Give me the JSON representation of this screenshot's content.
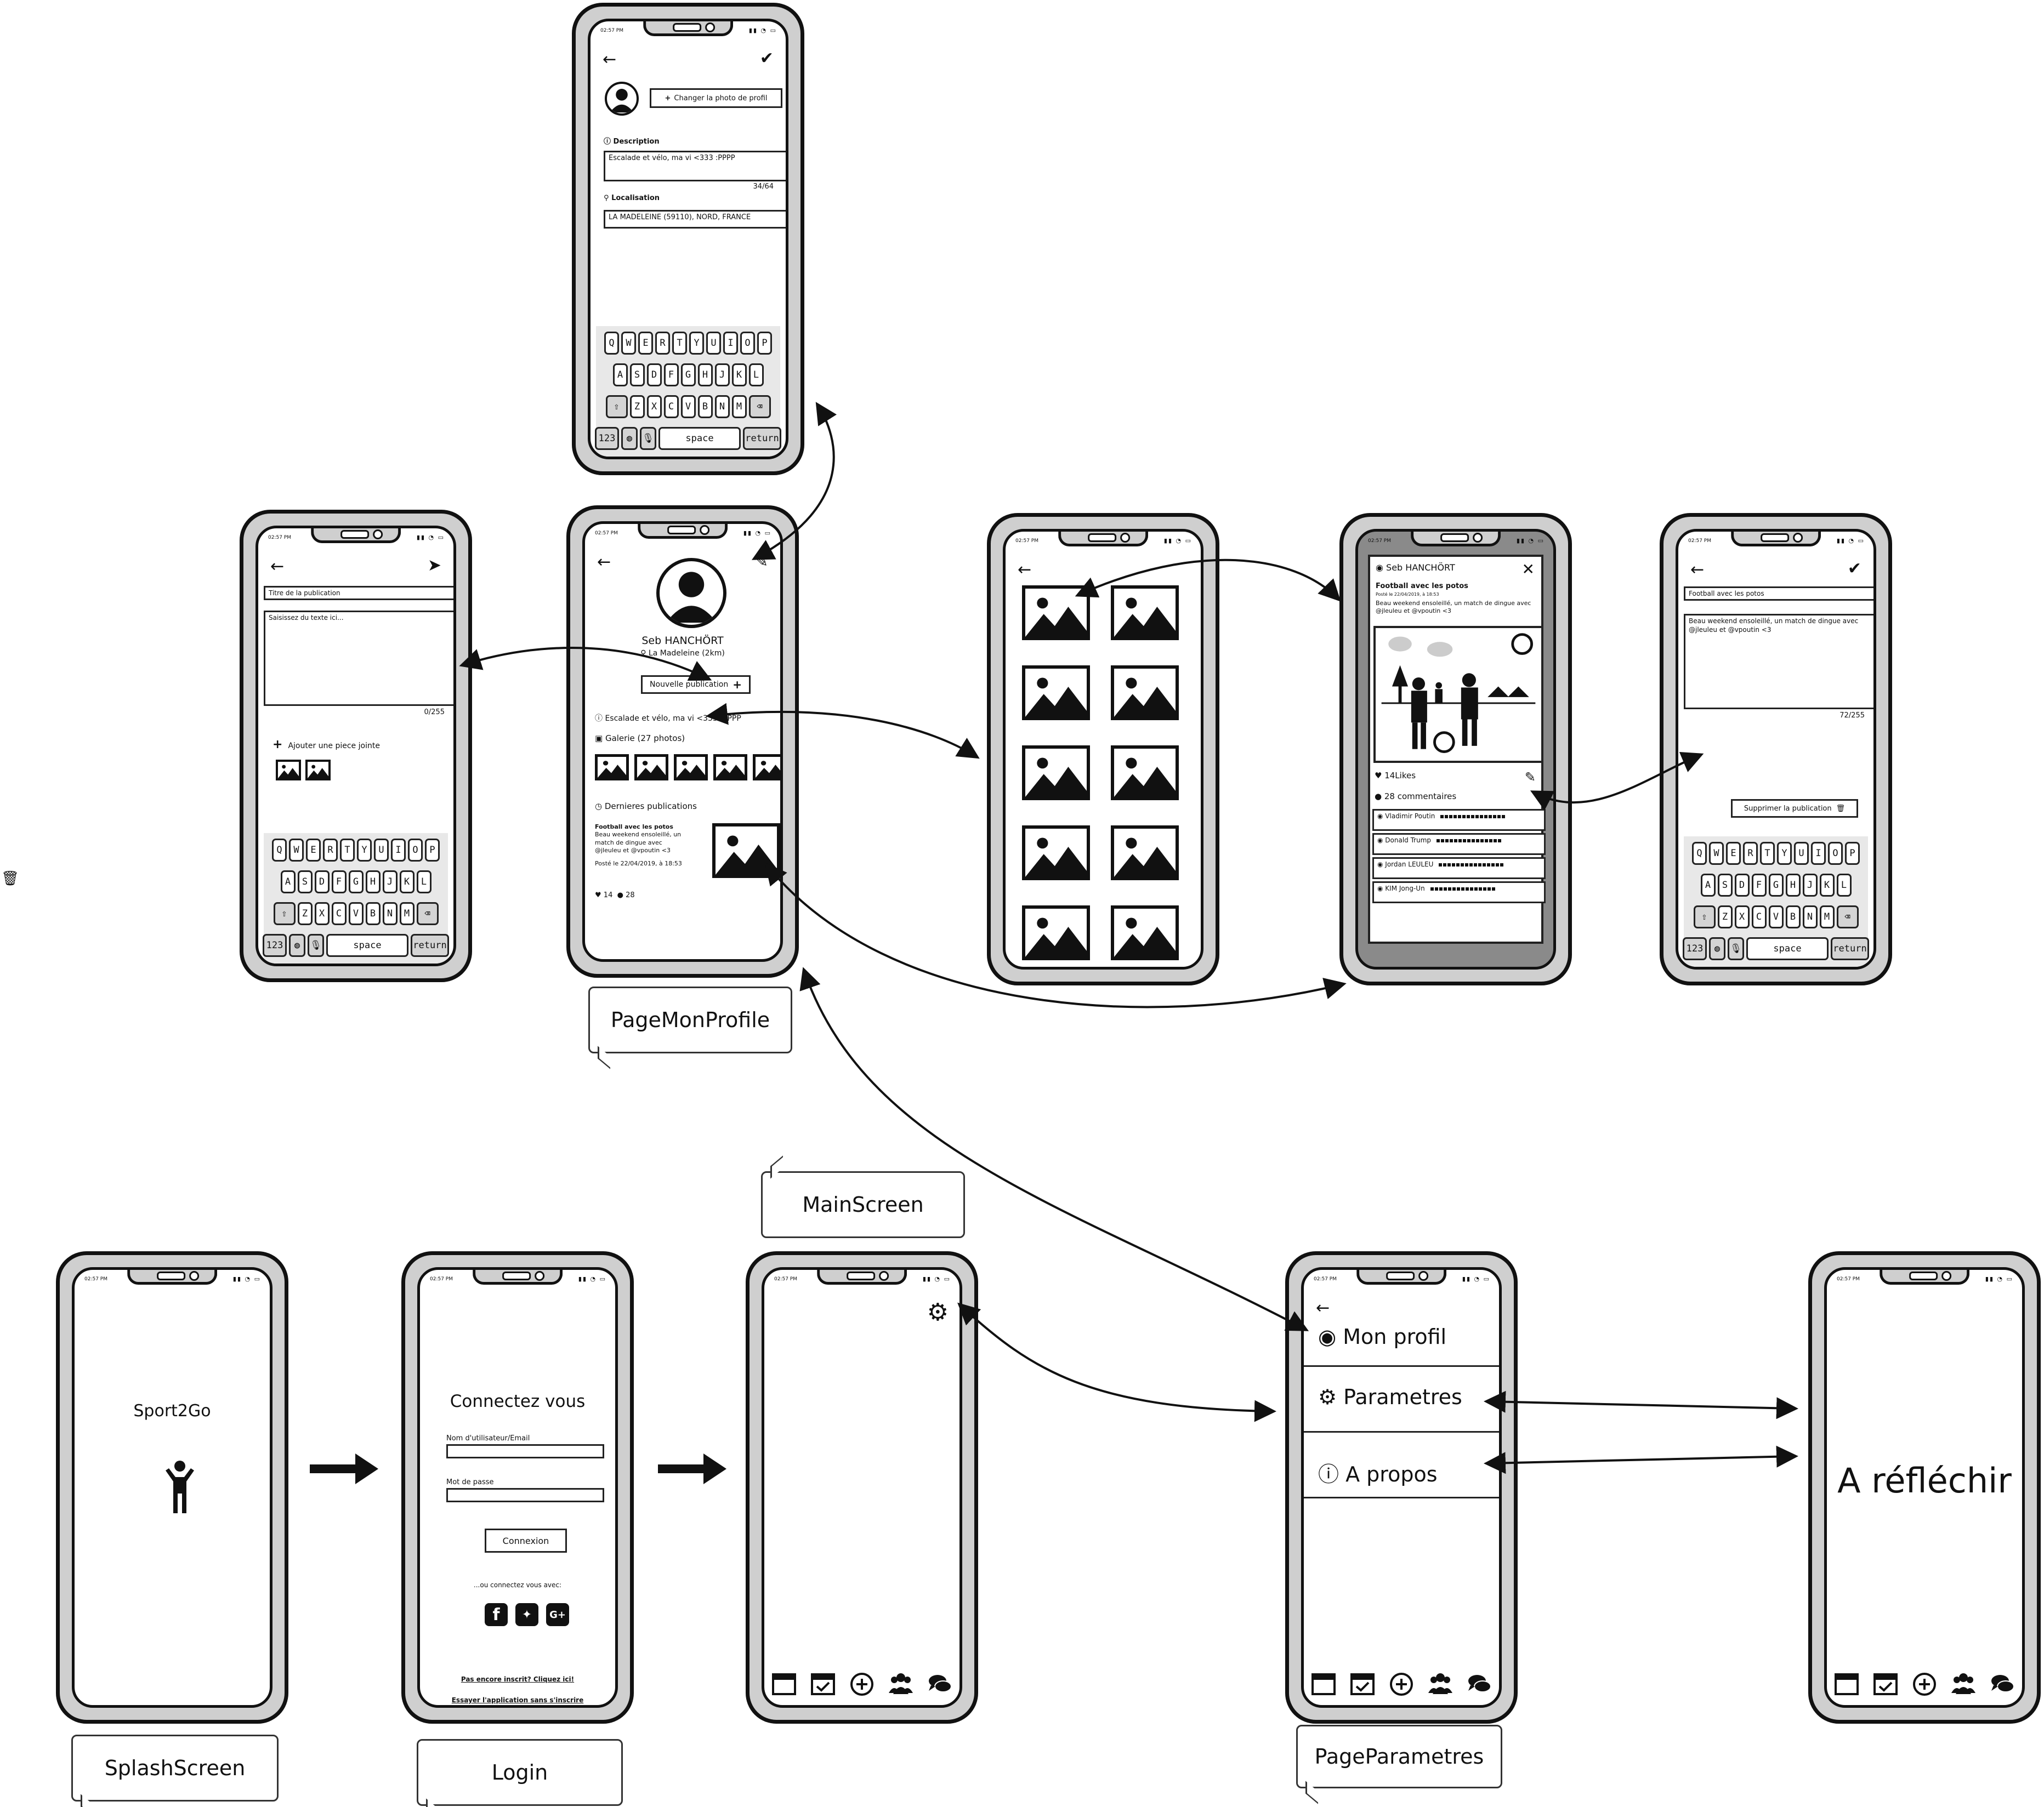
{
  "phones": {
    "status_time": "02:57 PM",
    "p_edit": {
      "change_photo": "Changer la photo de profil",
      "description_label": "Description",
      "description_value": "Escalade et vélo, ma vi <333 :PPPP",
      "description_count": "34/64",
      "location_label": "Localisation",
      "location_value": "LA MADELEINE (59110), NORD, FRANCE"
    },
    "p_newpost": {
      "title_placeholder": "Titre de la publication",
      "text_placeholder": "Saisissez du texte ici...",
      "count": "0/255",
      "attach_label": "Ajouter une piece jointe"
    },
    "p_profile": {
      "name": "Seb HANCHÖRT",
      "location": "La Madeleine (2km)",
      "new_post_button": "Nouvelle publication",
      "bio": "Escalade et vélo, ma vi <333 :PPPP",
      "gallery_label": "Galerie (27 photos)",
      "recent_label": "Dernieres publications",
      "post_title": "Football avec les potos",
      "post_body": "Beau weekend ensoleillé, un match de dingue avec @jleuleu et @vpoutin <3",
      "post_date": "Posté le 22/04/2019, à 18:53",
      "likes": "14",
      "comments": "28"
    },
    "p_post": {
      "author": "Seb HANCHÖRT",
      "title": "Football avec les potos",
      "date": "Posté le 22/04/2019, à 18:53",
      "body": "Beau weekend ensoleillé, un match de dingue avec @jleuleu et @vpoutin <3",
      "likes": "14Likes",
      "comments": "28 commentaires",
      "commenters": [
        "Vladimir Poutin",
        "Donald Trump",
        "Jordan LEULEU",
        "KIM Jong-Un"
      ]
    },
    "p_editpost": {
      "title_value": "Football avec les potos",
      "body_value": "Beau weekend ensoleillé, un match de dingue avec @jleuleu et @vpoutin <3",
      "count": "72/255",
      "delete_button": "Supprimer la publication"
    },
    "keyboard": {
      "row1": [
        "Q",
        "W",
        "E",
        "R",
        "T",
        "Y",
        "U",
        "I",
        "O",
        "P"
      ],
      "row2": [
        "A",
        "S",
        "D",
        "F",
        "G",
        "H",
        "J",
        "K",
        "L"
      ],
      "row3": [
        "Z",
        "X",
        "C",
        "V",
        "B",
        "N",
        "M"
      ],
      "num": "123",
      "space": "space",
      "return": "return"
    },
    "p_splash": {
      "app_name": "Sport2Go"
    },
    "p_login": {
      "title": "Connectez vous",
      "username_label": "Nom d'utilisateur/Email",
      "password_label": "Mot de passe",
      "login_button": "Connexion",
      "social_label": "...ou connectez vous avec:",
      "signup_link": "Pas encore inscrit? Cliquez ici!",
      "try_link": "Essayer l'application sans s'inscrire"
    },
    "p_params": {
      "items": [
        "Mon profil",
        "Parametres",
        "A propos"
      ]
    },
    "p_todo": {
      "text": "A réfléchir"
    }
  },
  "callouts": {
    "profile": "PageMonProfile",
    "main": "MainScreen",
    "splash": "SplashScreen",
    "login": "Login",
    "params": "PageParametres"
  },
  "colors": {
    "phone_body": "#cfcfcf",
    "outline": "#111111"
  }
}
